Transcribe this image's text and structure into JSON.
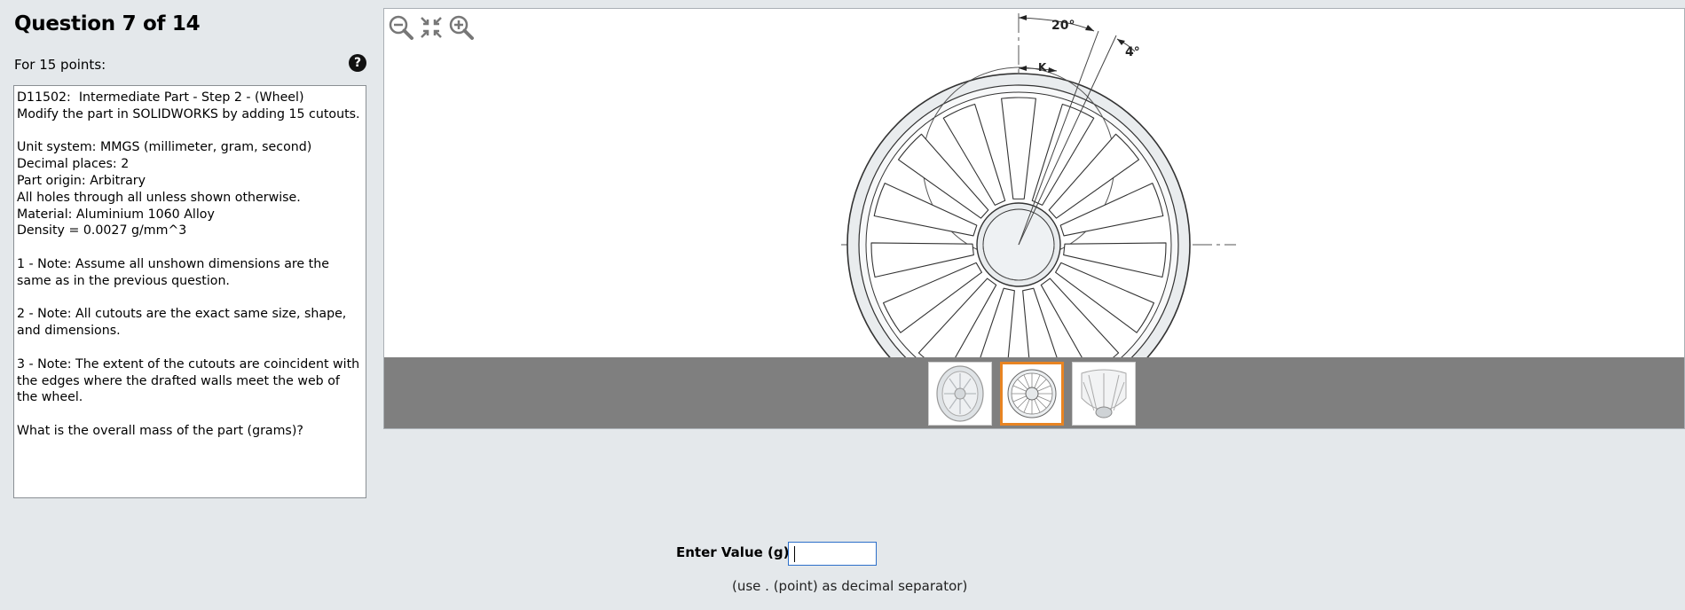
{
  "question": {
    "title": "Question 7 of 14",
    "points": "For 15 points:",
    "help_icon": "question-circle-icon",
    "text": "D11502:  Intermediate Part - Step 2 - (Wheel)\nModify the part in SOLIDWORKS by adding 15 cutouts.\n\nUnit system: MMGS (millimeter, gram, second)\nDecimal places: 2\nPart origin: Arbitrary\nAll holes through all unless shown otherwise.\nMaterial: Aluminium 1060 Alloy\nDensity = 0.0027 g/mm^3\n\n1 - Note: Assume all unshown dimensions are the same as in the previous question.\n\n2 - Note: All cutouts are the exact same size, shape, and dimensions.\n\n3 - Note: The extent of the cutouts are coincident with the edges where the drafted walls meet the web of the wheel.\n\nWhat is the overall mass of the part (grams)?"
  },
  "viewer": {
    "toolbar": [
      "zoom-out-icon",
      "fit-to-screen-icon",
      "zoom-in-icon"
    ],
    "drawing": {
      "angle_20": "20°",
      "angle_4": "4°",
      "label_k": "K"
    },
    "thumbnails": [
      {
        "name": "thumbnail-1",
        "active": false
      },
      {
        "name": "thumbnail-2",
        "active": true
      },
      {
        "name": "thumbnail-3",
        "active": false
      }
    ]
  },
  "answer": {
    "label": "Enter Value (g):",
    "value": "",
    "hint": "(use . (point) as decimal separator)"
  },
  "colors": {
    "background": "#e4e8eb",
    "thumbnail_strip": "#7f7f7f",
    "active_thumb_border": "#e88422",
    "input_border": "#2c6fc9"
  }
}
